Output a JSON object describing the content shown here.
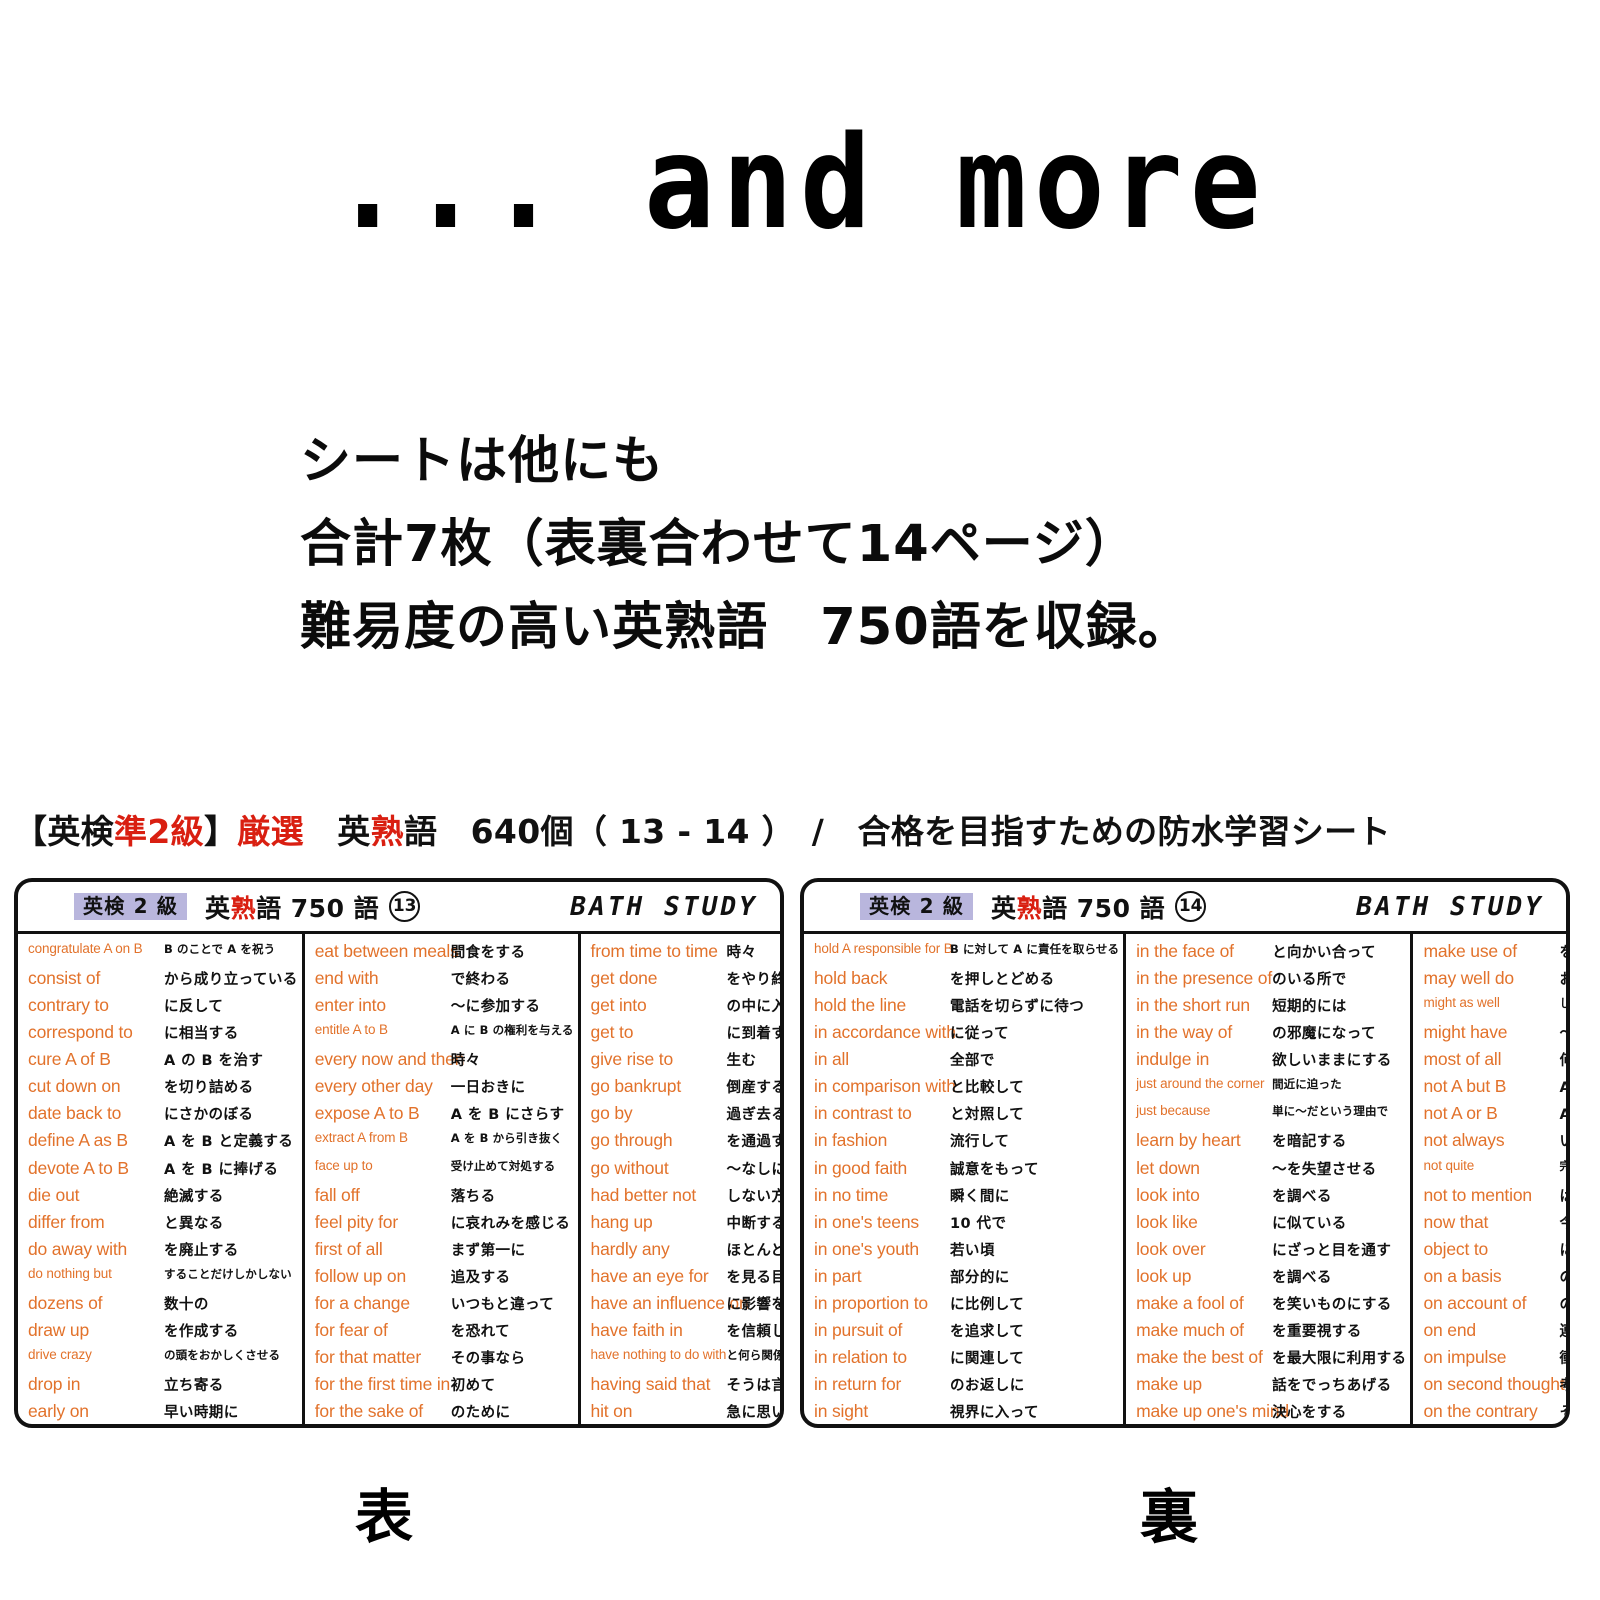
{
  "hero": {
    "title": "... and more"
  },
  "description": {
    "lines": [
      "シートは他にも",
      "合計7枚（表裏合わせて14ページ）",
      "難易度の高い英熟語　750語を収録。"
    ]
  },
  "caption": {
    "prefix": "【英検",
    "accent1": "準2級",
    "mid1": "】",
    "accent2": "厳選",
    "mid2": "　英",
    "accent3": "熟",
    "suffix": "語　640個（ 13 - 14 ）　/　合格を目指すための防水学習シート"
  },
  "colors": {
    "english_term": "#e2722b",
    "accent_red": "#d91f11",
    "badge_purple": "#b9b6dd",
    "ink": "#111111"
  },
  "sheets": [
    {
      "side_label": "表",
      "header": {
        "grade_badge": "英検 2 級",
        "title_prefix": "英",
        "title_red": "熟",
        "title_suffix": "語 750 語",
        "page_number": "13",
        "brand": "BATH STUDY"
      },
      "columns": [
        {
          "rows": [
            {
              "en": "congratulate A on B",
              "jp": "B のことで A を祝う",
              "small": true
            },
            {
              "en": "consist of",
              "jp": "から成り立っている",
              "small": false
            },
            {
              "en": "contrary to",
              "jp": "に反して",
              "small": false
            },
            {
              "en": "correspond to",
              "jp": "に相当する",
              "small": false
            },
            {
              "en": "cure A of B",
              "jp": "A の B を治す",
              "small": false
            },
            {
              "en": "cut down on",
              "jp": "を切り詰める",
              "small": false
            },
            {
              "en": "date back to",
              "jp": "にさかのぼる",
              "small": false
            },
            {
              "en": "define A as B",
              "jp": "A を B と定義する",
              "small": false
            },
            {
              "en": "devote A to B",
              "jp": "A を B に捧げる",
              "small": false
            },
            {
              "en": "die out",
              "jp": "絶滅する",
              "small": false
            },
            {
              "en": "differ from",
              "jp": "と異なる",
              "small": false
            },
            {
              "en": "do away with",
              "jp": "を廃止する",
              "small": false
            },
            {
              "en": "do nothing but",
              "jp": "することだけしかしない",
              "small": true
            },
            {
              "en": "dozens of",
              "jp": "数十の",
              "small": false
            },
            {
              "en": "draw up",
              "jp": "を作成する",
              "small": false
            },
            {
              "en": "drive crazy",
              "jp": "の頭をおかしくさせる",
              "small": true
            },
            {
              "en": "drop in",
              "jp": "立ち寄る",
              "small": false
            },
            {
              "en": "early on",
              "jp": "早い時期に",
              "small": false
            }
          ]
        },
        {
          "rows": [
            {
              "en": "eat between meals",
              "jp": "間食をする",
              "small": false
            },
            {
              "en": "end with",
              "jp": "で終わる",
              "small": false
            },
            {
              "en": "enter into",
              "jp": "〜に参加する",
              "small": false
            },
            {
              "en": "entitle A to B",
              "jp": "A に B の権利を与える",
              "small": true
            },
            {
              "en": "every now and then",
              "jp": "時々",
              "small": false
            },
            {
              "en": "every other day",
              "jp": "一日おきに",
              "small": false
            },
            {
              "en": "expose A to B",
              "jp": "A を B にさらす",
              "small": false
            },
            {
              "en": "extract A from B",
              "jp": "A を B から引き抜く",
              "small": true
            },
            {
              "en": "face up to",
              "jp": "受け止めて対処する",
              "small": true
            },
            {
              "en": "fall off",
              "jp": "落ちる",
              "small": false
            },
            {
              "en": "feel pity for",
              "jp": "に哀れみを感じる",
              "small": false
            },
            {
              "en": "first of all",
              "jp": "まず第一に",
              "small": false
            },
            {
              "en": "follow up on",
              "jp": "追及する",
              "small": false
            },
            {
              "en": "for a change",
              "jp": "いつもと違って",
              "small": false
            },
            {
              "en": "for fear of",
              "jp": "を恐れて",
              "small": false
            },
            {
              "en": "for that matter",
              "jp": "その事なら",
              "small": false
            },
            {
              "en": "for the first time in",
              "jp": "初めて",
              "small": false
            },
            {
              "en": "for the sake of",
              "jp": "のために",
              "small": false
            }
          ]
        },
        {
          "rows": [
            {
              "en": "from time to time",
              "jp": "時々",
              "small": false
            },
            {
              "en": "get done",
              "jp": "をやり終える",
              "small": false
            },
            {
              "en": "get into",
              "jp": "の中に入る",
              "small": false
            },
            {
              "en": "get to",
              "jp": "に到着する",
              "small": false
            },
            {
              "en": "give rise to",
              "jp": "生む",
              "small": false
            },
            {
              "en": "go bankrupt",
              "jp": "倒産する",
              "small": false
            },
            {
              "en": "go by",
              "jp": "過ぎ去る",
              "small": false
            },
            {
              "en": "go through",
              "jp": "を通過する",
              "small": false
            },
            {
              "en": "go without",
              "jp": "〜なしに済ます",
              "small": false
            },
            {
              "en": "had better not",
              "jp": "しない方が良い",
              "small": false
            },
            {
              "en": "hang up",
              "jp": "中断する",
              "small": false
            },
            {
              "en": "hardly any",
              "jp": "ほとんどがない",
              "small": false
            },
            {
              "en": "have an eye for",
              "jp": "を見る目がある",
              "small": false
            },
            {
              "en": "have an influence on",
              "jp": "に影響を与える",
              "small": false
            },
            {
              "en": "have faith in",
              "jp": "を信頼している",
              "small": false
            },
            {
              "en": "have nothing to do with",
              "jp": "と何ら関係がない",
              "small": true
            },
            {
              "en": "having said that",
              "jp": "そうは言っても",
              "small": false
            },
            {
              "en": "hit on",
              "jp": "急に思いつく",
              "small": false
            }
          ]
        }
      ]
    },
    {
      "side_label": "裏",
      "header": {
        "grade_badge": "英検 2 級",
        "title_prefix": "英",
        "title_red": "熟",
        "title_suffix": "語 750 語",
        "page_number": "14",
        "brand": "BATH STUDY"
      },
      "columns": [
        {
          "rows": [
            {
              "en": "hold A responsible for B",
              "jp": "B に対して A に責任を取らせる",
              "small": true
            },
            {
              "en": "hold back",
              "jp": "を押しとどめる",
              "small": false
            },
            {
              "en": "hold the line",
              "jp": "電話を切らずに待つ",
              "small": false
            },
            {
              "en": "in accordance with",
              "jp": "に従って",
              "small": false
            },
            {
              "en": "in all",
              "jp": "全部で",
              "small": false
            },
            {
              "en": "in comparison with",
              "jp": "と比較して",
              "small": false
            },
            {
              "en": "in contrast to",
              "jp": "と対照して",
              "small": false
            },
            {
              "en": "in fashion",
              "jp": "流行して",
              "small": false
            },
            {
              "en": "in good faith",
              "jp": "誠意をもって",
              "small": false
            },
            {
              "en": "in no time",
              "jp": "瞬く間に",
              "small": false
            },
            {
              "en": "in one's teens",
              "jp": "10 代で",
              "small": false
            },
            {
              "en": "in one's youth",
              "jp": "若い頃",
              "small": false
            },
            {
              "en": "in part",
              "jp": "部分的に",
              "small": false
            },
            {
              "en": "in proportion to",
              "jp": "に比例して",
              "small": false
            },
            {
              "en": "in pursuit of",
              "jp": "を追求して",
              "small": false
            },
            {
              "en": "in relation to",
              "jp": "に関連して",
              "small": false
            },
            {
              "en": "in return for",
              "jp": "のお返しに",
              "small": false
            },
            {
              "en": "in sight",
              "jp": "視界に入って",
              "small": false
            }
          ]
        },
        {
          "rows": [
            {
              "en": "in the face of",
              "jp": "と向かい合って",
              "small": false
            },
            {
              "en": "in the presence of",
              "jp": "のいる所で",
              "small": false
            },
            {
              "en": "in the short run",
              "jp": "短期的には",
              "small": false
            },
            {
              "en": "in the way of",
              "jp": "の邪魔になって",
              "small": false
            },
            {
              "en": "indulge in",
              "jp": "欲しいままにする",
              "small": false
            },
            {
              "en": "just around the corner",
              "jp": "間近に迫った",
              "small": true
            },
            {
              "en": "just because",
              "jp": "単に〜だという理由で",
              "small": true
            },
            {
              "en": "learn by heart",
              "jp": "を暗記する",
              "small": false
            },
            {
              "en": "let down",
              "jp": "〜を失望させる",
              "small": false
            },
            {
              "en": "look into",
              "jp": "を調べる",
              "small": false
            },
            {
              "en": "look like",
              "jp": "に似ている",
              "small": false
            },
            {
              "en": "look over",
              "jp": "にざっと目を通す",
              "small": false
            },
            {
              "en": "look up",
              "jp": "を調べる",
              "small": false
            },
            {
              "en": "make a fool of",
              "jp": "を笑いものにする",
              "small": false
            },
            {
              "en": "make much of",
              "jp": "を重要視する",
              "small": false
            },
            {
              "en": "make the best of",
              "jp": "を最大限に利用する",
              "small": false
            },
            {
              "en": "make up",
              "jp": "話をでっちあげる",
              "small": false
            },
            {
              "en": "make up one's mind",
              "jp": "決心をする",
              "small": false
            }
          ]
        },
        {
          "rows": [
            {
              "en": "make use of",
              "jp": "を利用する",
              "small": false
            },
            {
              "en": "may well do",
              "jp": "おそらく〜するだろう",
              "small": false
            },
            {
              "en": "might as well",
              "jp": "した方がいいかもしれない",
              "small": true
            },
            {
              "en": "might have",
              "jp": "〜したかもしれない",
              "small": false
            },
            {
              "en": "most of all",
              "jp": "何よりも",
              "small": false
            },
            {
              "en": "not A but B",
              "jp": "A ではなく B",
              "small": false
            },
            {
              "en": "not A or B",
              "jp": "A でも B でもない",
              "small": false
            },
            {
              "en": "not always",
              "jp": "いつでもとは限らない",
              "small": false
            },
            {
              "en": "not quite",
              "jp": "完全にというわけではない",
              "small": true
            },
            {
              "en": "not to mention",
              "jp": "は言うまでもなく",
              "small": false
            },
            {
              "en": "now that",
              "jp": "今はもう〜なので",
              "small": false
            },
            {
              "en": "object to",
              "jp": "に反対の意思を表す",
              "small": false
            },
            {
              "en": "on a basis",
              "jp": "の基準で",
              "small": false
            },
            {
              "en": "on account of",
              "jp": "のために",
              "small": false
            },
            {
              "en": "on end",
              "jp": "連続して",
              "small": false
            },
            {
              "en": "on impulse",
              "jp": "衝動的に",
              "small": false
            },
            {
              "en": "on second thought",
              "jp": "考え直してみて",
              "small": false
            },
            {
              "en": "on the contrary",
              "jp": "その正反対で",
              "small": false
            }
          ]
        }
      ]
    }
  ]
}
